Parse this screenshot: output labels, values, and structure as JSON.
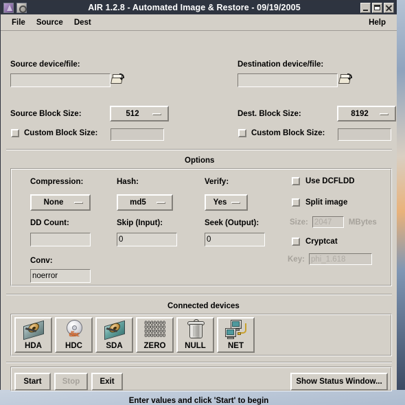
{
  "window": {
    "title": "AIR 1.2.8 - Automated Image & Restore - 09/19/2005",
    "app_icon_1": "star-app-icon",
    "app_icon_2": "camera-icon",
    "minimize_label": "minimize-icon",
    "maximize_label": "maximize-icon",
    "close_label": "close-icon"
  },
  "menubar": {
    "items": [
      {
        "label": "File"
      },
      {
        "label": "Source"
      },
      {
        "label": "Dest"
      }
    ],
    "help": "Help"
  },
  "source": {
    "device_label": "Source device/file:",
    "device_value": "",
    "browse_icon": "open-folder-icon",
    "block_size_label": "Source Block Size:",
    "block_size_value": "512",
    "custom_block_label": "Custom Block Size:",
    "custom_block_checked": false,
    "custom_block_value": ""
  },
  "destination": {
    "device_label": "Destination device/file:",
    "device_value": "",
    "browse_icon": "open-folder-icon",
    "block_size_label": "Dest. Block Size:",
    "block_size_value": "8192",
    "custom_block_label": "Custom Block Size:",
    "custom_block_checked": false,
    "custom_block_value": ""
  },
  "options": {
    "section_title": "Options",
    "compression_label": "Compression:",
    "compression_value": "None",
    "hash_label": "Hash:",
    "hash_value": "md5",
    "verify_label": "Verify:",
    "verify_value": "Yes",
    "dd_count_label": "DD Count:",
    "dd_count_value": "",
    "skip_label": "Skip (Input):",
    "skip_value": "0",
    "seek_label": "Seek (Output):",
    "seek_value": "0",
    "conv_label": "Conv:",
    "conv_value": "noerror",
    "use_dcfldd_label": "Use DCFLDD",
    "use_dcfldd_checked": false,
    "split_image_label": "Split image",
    "split_image_checked": false,
    "size_label": "Size:",
    "size_value": "2047",
    "size_units": "MBytes",
    "cryptcat_label": "Cryptcat",
    "cryptcat_checked": false,
    "key_label": "Key:",
    "key_value": "phi_1.618"
  },
  "devices": {
    "section_title": "Connected devices",
    "items": [
      {
        "label": "HDA",
        "icon": "hard-disk-icon"
      },
      {
        "label": "HDC",
        "icon": "cdrom-disc-icon"
      },
      {
        "label": "SDA",
        "icon": "scsi-disk-icon"
      },
      {
        "label": "ZERO",
        "icon": "zeros-grid-icon"
      },
      {
        "label": "NULL",
        "icon": "trash-can-icon"
      },
      {
        "label": "NET",
        "icon": "network-computers-icon"
      }
    ],
    "zero_rows": [
      "0000000",
      "0000000",
      "0000000",
      "0000000"
    ]
  },
  "actions": {
    "start": "Start",
    "stop": "Stop",
    "stop_disabled": true,
    "exit": "Exit",
    "show_status": "Show Status Window..."
  },
  "status": {
    "message": "Enter values and click 'Start' to begin"
  },
  "colors": {
    "titlebar_bg": "#2e3440",
    "window_bg": "#d4d0c8",
    "field_bg": "#d9d6cf",
    "text": "#000000",
    "disabled_text": "#a6a29b"
  }
}
